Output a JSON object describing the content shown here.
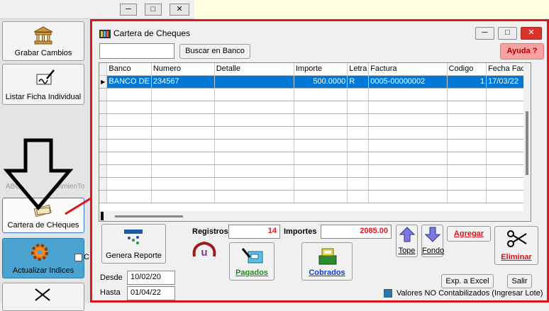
{
  "sidebar": {
    "grabar_label": "Grabar Cambios",
    "listar_label": "Listar Ficha Individual",
    "abc_faded": "ABC",
    "mov_faded": "vimienTo",
    "cartera_label": "Cartera de CHeques",
    "actualizar_label": "Actualizar Indices",
    "checkbox_label": "C"
  },
  "window": {
    "title": "Cartera de Cheques",
    "search_value": "",
    "search_button": "Buscar en Banco",
    "help_button": "Ayuda ?"
  },
  "grid": {
    "columns": [
      "Banco",
      "Numero",
      "Detalle",
      "Importe",
      "Letra",
      "Factura",
      "Codigo",
      "Fecha Fac."
    ],
    "rows": [
      {
        "banco": "BANCO DE",
        "numero": "234567",
        "detalle": "",
        "importe": "500.0000",
        "letra": "R",
        "factura": "0005-00000002",
        "codigo": "1",
        "fecha": "17/03/22"
      }
    ],
    "empty_rows": 9
  },
  "footer": {
    "genera_reporte": "Genera Reporte",
    "registros_label": "Registros",
    "registros_value": "14",
    "importes_label": "Importes",
    "importes_value": "2085.00",
    "pagados": "Pagados",
    "cobrados": "Cobrados",
    "tope": "Tope",
    "fondo": "Fondo",
    "agregar": "Agregar",
    "eliminar": "Eliminar",
    "desde_label": "Desde",
    "desde_value": "10/02/20",
    "hasta_label": "Hasta",
    "hasta_value": "01/04/22",
    "exp_excel": "Exp. a Excel",
    "salir": "Salir",
    "legend_text": "Valores NO Contabilizados (Ingresar Lote)"
  },
  "colors": {
    "frame_red": "#e0151c",
    "selection_blue": "#0078d7",
    "help_bg": "#f7a1a1",
    "legend_square": "#1f7ab8"
  }
}
